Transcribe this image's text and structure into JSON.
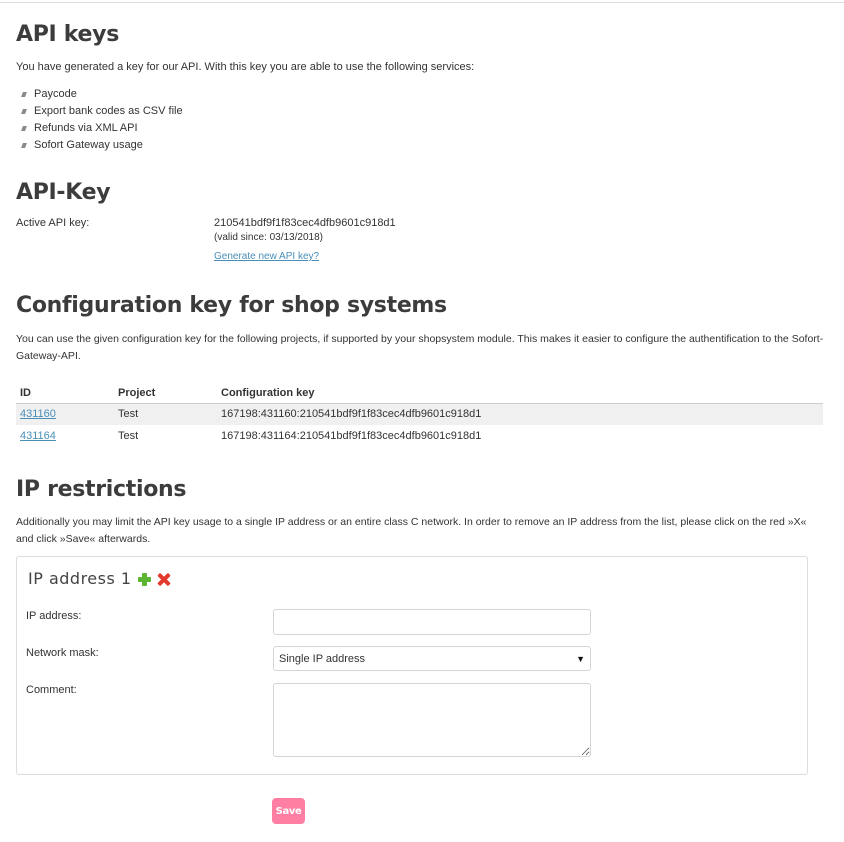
{
  "api_keys": {
    "title": "API keys",
    "intro": "You have generated a key for our API. With this key you are able to use the following services:",
    "services": [
      "Paycode",
      "Export bank codes as CSV file",
      "Refunds via XML API",
      "Sofort Gateway usage"
    ]
  },
  "api_key": {
    "title": "API-Key",
    "active_label": "Active API key:",
    "value": "210541bdf9f1f83cec4dfb9601c918d1",
    "valid_since": "(valid since: 03/13/2018)",
    "generate_link": "Generate new API key?"
  },
  "config": {
    "title": "Configuration key for shop systems",
    "description": "You can use the given configuration key for the following projects, if supported by your shopsystem module. This makes it easier to configure the authentification to the Sofort-Gateway-API.",
    "columns": [
      "ID",
      "Project",
      "Configuration key"
    ],
    "rows": [
      {
        "id": "431160",
        "project": "Test",
        "key": "167198:431160:210541bdf9f1f83cec4dfb9601c918d1"
      },
      {
        "id": "431164",
        "project": "Test",
        "key": "167198:431164:210541bdf9f1f83cec4dfb9601c918d1"
      }
    ]
  },
  "ip": {
    "title": "IP restrictions",
    "description": "Additionally you may limit the API key usage to a single IP address or an entire class C network. In order to remove an IP address from the list, please click on the red »X« and click »Save« afterwards.",
    "box_title": "IP address 1",
    "add_icon": "plus-icon",
    "remove_icon": "x-icon",
    "ip_label": "IP address:",
    "ip_value": "",
    "mask_label": "Network mask:",
    "mask_selected": "Single IP address",
    "comment_label": "Comment:",
    "comment_value": ""
  },
  "save_label": "Save",
  "colors": {
    "link": "#4a8fb8",
    "save_button": "#ff7fa3",
    "add_icon": "#5cb531",
    "remove_icon": "#e23b2e"
  }
}
